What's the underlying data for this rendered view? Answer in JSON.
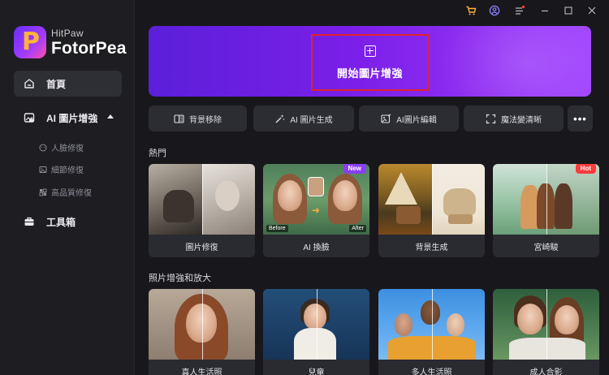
{
  "app": {
    "brand": "HitPaw",
    "product": "FotorPea"
  },
  "titlebar": {
    "icons": [
      "cart-icon",
      "account-icon",
      "menu-icon",
      "minimize-icon",
      "maximize-icon",
      "close-icon"
    ]
  },
  "sidebar": {
    "items": [
      {
        "label": "首頁",
        "icon": "home-icon",
        "active": true
      },
      {
        "label": "AI 圖片增強",
        "icon": "image-enhance-icon",
        "expanded": true
      },
      {
        "label": "工具箱",
        "icon": "toolbox-icon"
      }
    ],
    "sub_items": [
      {
        "label": "人臉修復",
        "icon": "face-icon"
      },
      {
        "label": "細節修復",
        "icon": "detail-icon"
      },
      {
        "label": "高品質修復",
        "icon": "quality-icon"
      }
    ]
  },
  "hero": {
    "label": "開始圖片增強",
    "icon": "plus-icon"
  },
  "tools": [
    {
      "label": "背景移除",
      "icon": "bg-remove-icon"
    },
    {
      "label": "AI 圖片生成",
      "icon": "magic-wand-icon"
    },
    {
      "label": "AI圖片編輯",
      "icon": "image-edit-icon"
    },
    {
      "label": "魔法變清晰",
      "icon": "expand-icon"
    }
  ],
  "more_button": "•••",
  "sections": {
    "hot": {
      "title": "熱門",
      "cards": [
        {
          "caption": "圖片修復",
          "badge": ""
        },
        {
          "caption": "AI 換臉",
          "badge": "New",
          "before": "Before",
          "after": "After"
        },
        {
          "caption": "背景生成",
          "badge": ""
        },
        {
          "caption": "宮崎駿",
          "badge": "Hot"
        }
      ]
    },
    "enhance": {
      "title": "照片增強和放大",
      "cards": [
        {
          "caption": "真人生活照"
        },
        {
          "caption": "兒童"
        },
        {
          "caption": "多人生活照"
        },
        {
          "caption": "成人合影"
        }
      ]
    }
  },
  "colors": {
    "accent": "#8a3df5",
    "hero_start": "#5b1fd9",
    "hero_end": "#a144ff",
    "highlight_border": "#e0242c",
    "hot_badge": "#ff3b3b",
    "cart_icon": "#ffb23a",
    "notification_dot": "#ff3b3b"
  }
}
